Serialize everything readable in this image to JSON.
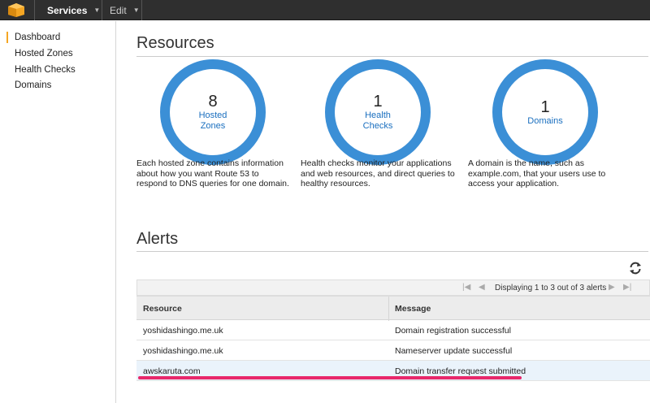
{
  "topbar": {
    "services_label": "Services",
    "edit_label": "Edit",
    "logo_color": "#f5a623"
  },
  "sidebar": {
    "items": [
      {
        "label": "Dashboard",
        "active": true
      },
      {
        "label": "Hosted Zones"
      },
      {
        "label": "Health Checks"
      },
      {
        "label": "Domains"
      }
    ]
  },
  "resources": {
    "title": "Resources",
    "cards": [
      {
        "count": "8",
        "label_line1": "Hosted",
        "label_line2": "Zones",
        "description": "Each hosted zone contains information about how you want Route 53 to respond to DNS queries for one domain."
      },
      {
        "count": "1",
        "label_line1": "Health",
        "label_line2": "Checks",
        "description": "Health checks monitor your applications and web resources, and direct queries to healthy resources."
      },
      {
        "count": "1",
        "label_line1": "Domains",
        "label_line2": "",
        "description": "A domain is the name, such as example.com, that your users use to access your application."
      }
    ],
    "ring_color": "#3b8fd6"
  },
  "alerts": {
    "title": "Alerts",
    "pager_text": "Displaying 1 to 3 out of 3 alerts",
    "columns": [
      "Resource",
      "Message"
    ],
    "rows": [
      {
        "resource": "yoshidashingo.me.uk",
        "message": "Domain registration successful"
      },
      {
        "resource": "yoshidashingo.me.uk",
        "message": "Nameserver update successful"
      },
      {
        "resource": "awskaruta.com",
        "message": "Domain transfer request submitted"
      }
    ],
    "highlight_color": "#e8286b"
  }
}
